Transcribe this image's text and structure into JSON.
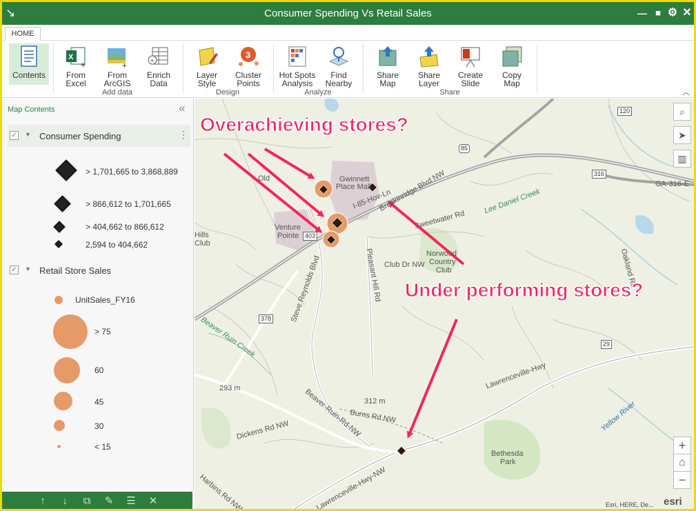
{
  "window": {
    "title": "Consumer Spending Vs Retail Sales",
    "buttons": {
      "minimize": "—",
      "maximize": "■",
      "settings": "⚙",
      "close": "✕"
    }
  },
  "ribbon": {
    "tab": "HOME",
    "groups": [
      {
        "label": "Add data"
      },
      {
        "label": "Design"
      },
      {
        "label": "Analyze"
      },
      {
        "label": "Share"
      }
    ],
    "buttons": {
      "contents": "Contents",
      "from_excel_1": "From",
      "from_excel_2": "Excel",
      "from_arcgis_1": "From",
      "from_arcgis_2": "ArcGIS",
      "enrich_1": "Enrich",
      "enrich_2": "Data",
      "layer_style_1": "Layer",
      "layer_style_2": "Style",
      "cluster_1": "Cluster",
      "cluster_2": "Points",
      "hotspots_1": "Hot Spots",
      "hotspots_2": "Analysis",
      "find_1": "Find",
      "find_2": "Nearby",
      "share_map_1": "Share",
      "share_map_2": "Map",
      "share_layer_1": "Share",
      "share_layer_2": "Layer",
      "create_slide_1": "Create",
      "create_slide_2": "Slide",
      "copy_map_1": "Copy",
      "copy_map_2": "Map"
    },
    "cluster_badge": "3"
  },
  "panel": {
    "title": "Map Contents",
    "layers": [
      {
        "name": "Consumer Spending",
        "legend": [
          "> 1,701,665 to 3,868,889",
          "> 866,612 to 1,701,665",
          "> 404,662 to 866,612",
          "2,594 to 404,662"
        ]
      },
      {
        "name": "Retail Store Sales",
        "field": "UnitSales_FY16",
        "legend": [
          "> 75",
          "60",
          "45",
          "30",
          "< 15"
        ]
      }
    ]
  },
  "map": {
    "annotations": {
      "over": "Overachieving stores?",
      "under": "Under performing stores?"
    },
    "labels": {
      "gwinnett": "Gwinnett",
      "place_mall": "Place Mall",
      "venture": "Venture",
      "pointe": "Pointe",
      "norwood1": "Norwood",
      "norwood2": "Country",
      "norwood3": "Club",
      "bethesda1": "Bethesda",
      "bethesda2": "Park",
      "i85": "I-85-Hov-Ln",
      "pleasant": "Pleasant Hill Rd",
      "steve": "Steve Reynolds Blvd",
      "lawrenceville": "Lawrenceville-Hwy",
      "beaver": "Beaver-Ruin-Rd-NW",
      "burns": "Burns Rd NW",
      "dickens": "Dickens Rd NW",
      "club": "Club Dr NW",
      "oakland": "Oakland Rd",
      "ga316": "GA-316-E",
      "elev1": "312 m",
      "elev2": "293 m",
      "yellow": "Yellow River",
      "lee": "Lee Daniel Creek",
      "sweetwater": "Sweetwater Rd",
      "breckinridge": "Breckinridge Blvd NW",
      "old": "Old",
      "hills": "Hills",
      "club2": "Club",
      "lawrenceville2": "Lawrenceville-Hwy-NW",
      "harbins": "Harbins Rd NW",
      "beaver_creek": "Beaver Ruin Creek"
    },
    "shields": [
      "120",
      "85",
      "316",
      "403",
      "378",
      "29"
    ],
    "attribution": "Esri, HERE, De...",
    "logo": "esri",
    "tools": {
      "search": "⌕",
      "select": "➤",
      "basemap": "▥",
      "zoom_in": "+",
      "home": "⌂",
      "zoom_out": "−"
    }
  },
  "bottombar": {
    "up": "↑",
    "down": "↓",
    "copy": "⧉",
    "rename": "✎",
    "list": "☰",
    "remove": "✕"
  },
  "colors": {
    "brand": "#2e7d3e",
    "accent": "#f5245e",
    "sales": "#e69a68",
    "frame": "#f0d80a"
  }
}
